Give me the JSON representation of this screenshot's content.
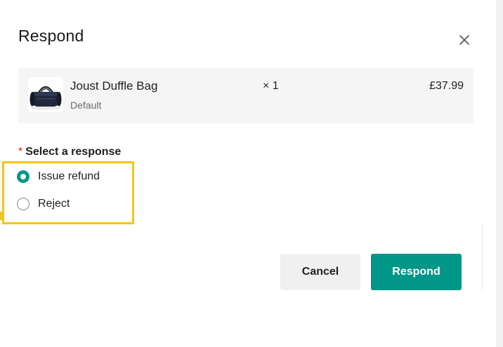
{
  "dialog": {
    "title": "Respond",
    "close_icon": "close-icon"
  },
  "item": {
    "name": "Joust Duffle Bag",
    "variant": "Default",
    "quantity": "× 1",
    "price": "£37.99",
    "thumbnail_icon": "duffle-bag-image"
  },
  "response_field": {
    "required_marker": "*",
    "label": "Select a response",
    "options": [
      {
        "label": "Issue refund",
        "selected": true
      },
      {
        "label": "Reject",
        "selected": false
      }
    ]
  },
  "actions": {
    "cancel_label": "Cancel",
    "respond_label": "Respond"
  },
  "colors": {
    "accent": "#009688",
    "highlight": "#f5c518",
    "required": "#d72c0d",
    "card_bg": "#f5f5f5"
  }
}
